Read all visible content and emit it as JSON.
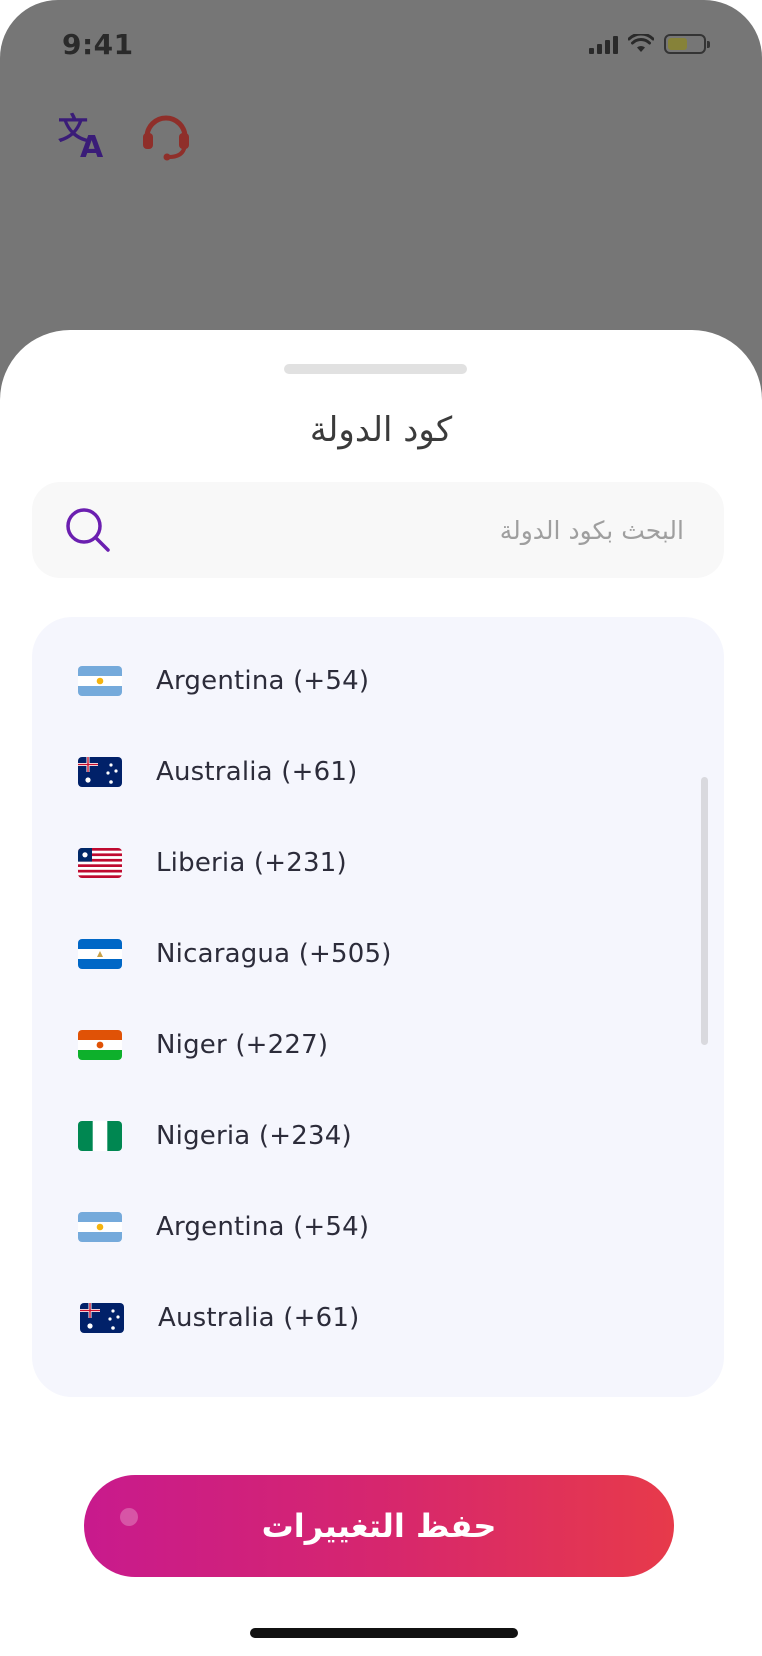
{
  "status_bar": {
    "time": "9:41",
    "battery_level": 0.55
  },
  "top_icons": [
    "translate-icon",
    "headset-support-icon"
  ],
  "sheet": {
    "title": "كود الدولة",
    "search": {
      "placeholder": "البحث بكود الدولة"
    },
    "countries": [
      {
        "label": "Argentina (+54)",
        "flag": "argentina-flag-icon"
      },
      {
        "label": "Australia (+61)",
        "flag": "australia-flag-icon"
      },
      {
        "label": "Liberia (+231)",
        "flag": "liberia-flag-icon"
      },
      {
        "label": "Nicaragua (+505)",
        "flag": "nicaragua-flag-icon"
      },
      {
        "label": "Niger (+227)",
        "flag": "niger-flag-icon"
      },
      {
        "label": "Nigeria (+234)",
        "flag": "nigeria-flag-icon"
      },
      {
        "label": "Argentina (+54)",
        "flag": "argentina-flag-icon"
      },
      {
        "label": "Australia (+61)",
        "flag": "australia-flag-icon"
      }
    ],
    "save_label": "حفظ التغييرات"
  },
  "colors": {
    "accent": "#6b1fb0",
    "button_gradient_start": "#c81a8d",
    "button_gradient_end": "#e73a4a",
    "list_background": "#f5f6fd"
  }
}
